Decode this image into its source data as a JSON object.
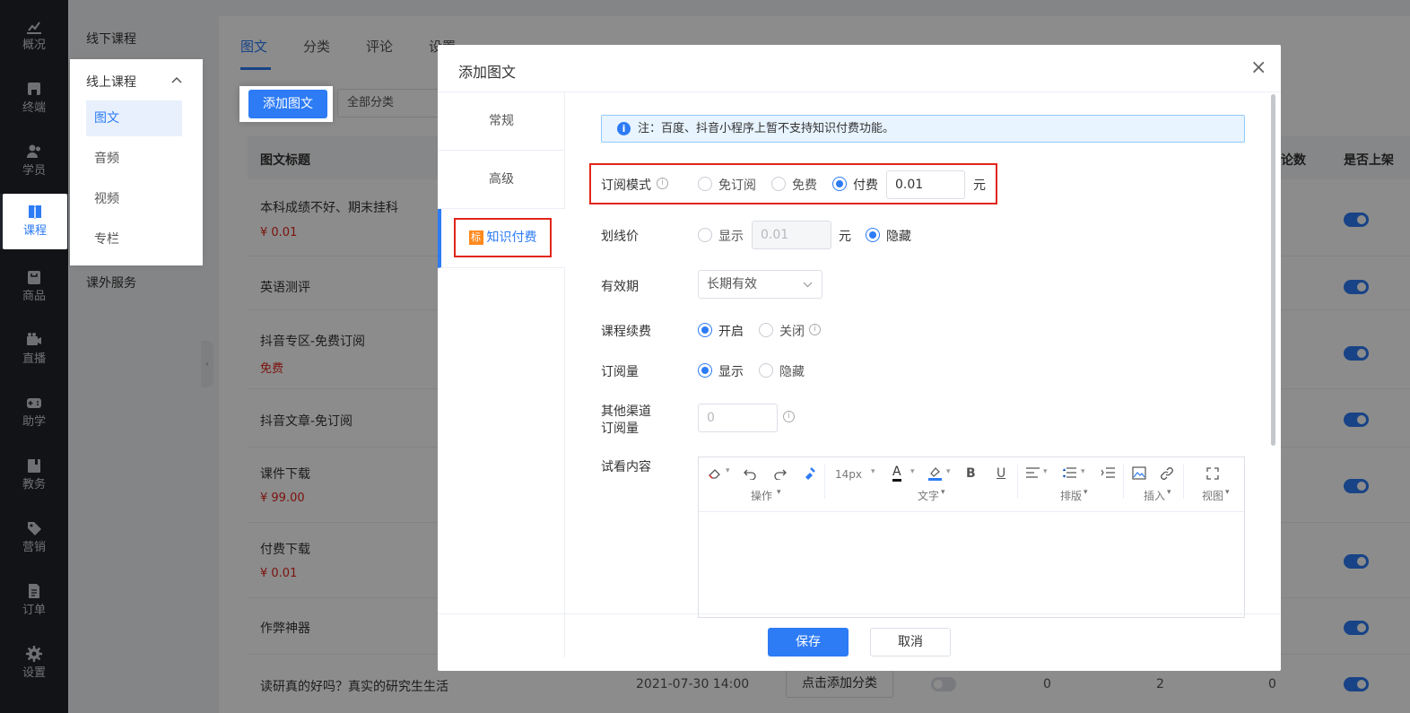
{
  "nav": {
    "items": [
      {
        "label": "概况",
        "icon": "chart-icon"
      },
      {
        "label": "终端",
        "icon": "terminal-icon"
      },
      {
        "label": "学员",
        "icon": "users-icon"
      },
      {
        "label": "课程",
        "icon": "book-icon"
      },
      {
        "label": "商品",
        "icon": "bag-icon"
      },
      {
        "label": "直播",
        "icon": "video-camera-icon"
      },
      {
        "label": "助学",
        "icon": "gamepad-icon"
      },
      {
        "label": "教务",
        "icon": "clipboard-icon"
      },
      {
        "label": "营销",
        "icon": "tag-icon"
      },
      {
        "label": "订单",
        "icon": "document-icon"
      },
      {
        "label": "设置",
        "icon": "gear-icon"
      }
    ],
    "active": "课程"
  },
  "subnav": {
    "offline": "线下课程",
    "online": "线上课程",
    "online_items": [
      "图文",
      "音频",
      "视频",
      "专栏"
    ],
    "extra": "课外服务"
  },
  "main": {
    "tabs": [
      "图文",
      "分类",
      "评论",
      "设置"
    ],
    "add_button": "添加图文",
    "category_select": "全部分类",
    "table_headers": {
      "title": "图文标题",
      "comments": "论数",
      "listed": "是否上架"
    },
    "rows": [
      {
        "title": "本科成绩不好、期末挂科",
        "price": "¥ 0.01"
      },
      {
        "title": "英语测评",
        "price": ""
      },
      {
        "title": "抖音专区-免费订阅",
        "price": "免费"
      },
      {
        "title": "抖音文章-免订阅",
        "price": ""
      },
      {
        "title": "课件下载",
        "price": "¥ 99.00"
      },
      {
        "title": "付费下载",
        "price": "¥ 0.01"
      },
      {
        "title": "作弊神器",
        "price": ""
      },
      {
        "title": "读研真的好吗？真实的研究生生活",
        "price": "",
        "date": "2021-07-30 14:00",
        "category_button": "点击添加分类",
        "n1": "0",
        "n2": "2",
        "n3": "0"
      }
    ]
  },
  "modal": {
    "title": "添加图文",
    "side_tabs": [
      "常规",
      "高级",
      "知识付费"
    ],
    "badge": "标",
    "notice": "注：百度、抖音小程序上暂不支持知识付费功能。",
    "notice_icon": "i",
    "subscribe_mode": {
      "label": "订阅模式",
      "options": [
        "免订阅",
        "免费",
        "付费"
      ],
      "selected": "付费",
      "value": "0.01",
      "unit": "元"
    },
    "strike_price": {
      "label": "划线价",
      "show": "显示",
      "value": "0.01",
      "unit": "元",
      "hide": "隐藏",
      "selected": "隐藏"
    },
    "validity": {
      "label": "有效期",
      "value": "长期有效"
    },
    "renewal": {
      "label": "课程续费",
      "on": "开启",
      "off": "关闭",
      "selected": "开启"
    },
    "sub_count": {
      "label": "订阅量",
      "show": "显示",
      "hide": "隐藏",
      "selected": "显示"
    },
    "other_channel": {
      "label_line1": "其他渠道",
      "label_line2": "订阅量",
      "placeholder": "0"
    },
    "preview": {
      "label": "试看内容"
    },
    "editor": {
      "font_size": "14px",
      "groups": [
        "操作",
        "文字",
        "排版",
        "插入",
        "视图"
      ]
    },
    "save": "保存",
    "cancel": "取消",
    "close_symbol": "×"
  }
}
